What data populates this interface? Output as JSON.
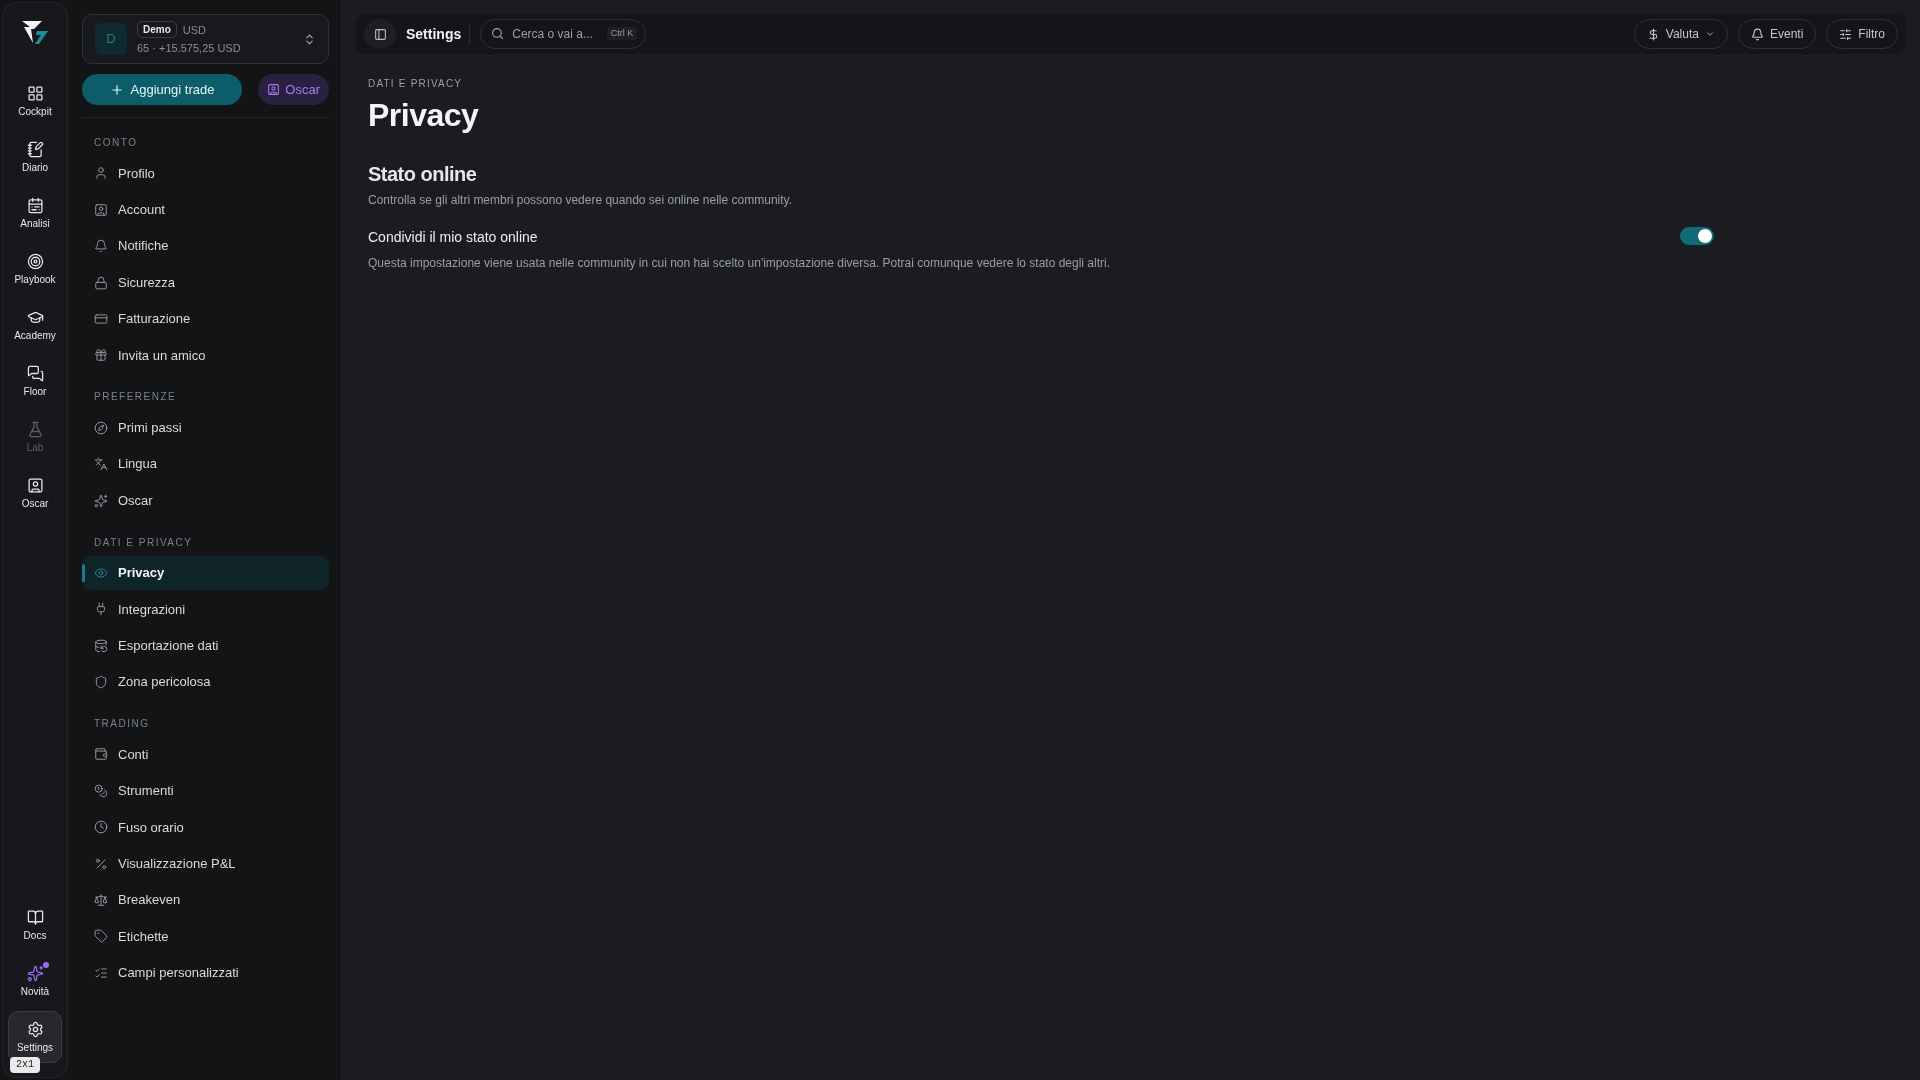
{
  "rail": {
    "top": [
      {
        "label": "Cockpit",
        "selected": false,
        "disabled": false,
        "has_dot": false
      },
      {
        "label": "Diario",
        "selected": false,
        "disabled": false,
        "has_dot": false
      },
      {
        "label": "Analisi",
        "selected": false,
        "disabled": false,
        "has_dot": false
      },
      {
        "label": "Playbook",
        "selected": false,
        "disabled": false,
        "has_dot": false
      },
      {
        "label": "Academy",
        "selected": false,
        "disabled": false,
        "has_dot": false
      },
      {
        "label": "Floor",
        "selected": false,
        "disabled": false,
        "has_dot": false
      },
      {
        "label": "Lab",
        "selected": false,
        "disabled": true,
        "has_dot": false
      },
      {
        "label": "Oscar",
        "selected": false,
        "disabled": false,
        "has_dot": false
      }
    ],
    "bottom": [
      {
        "label": "Docs",
        "selected": false,
        "disabled": false,
        "has_dot": false
      },
      {
        "label": "Novità",
        "selected": false,
        "disabled": false,
        "has_dot": true
      },
      {
        "label": "Settings",
        "selected": true,
        "disabled": false,
        "has_dot": false
      }
    ],
    "badge": "2x1"
  },
  "account": {
    "avatar": "D",
    "mode": "Demo",
    "currency": "USD",
    "summary": "65 · +15.575,25 USD"
  },
  "actions": {
    "add_trade": "Aggiungi trade",
    "oscar": "Oscar"
  },
  "sidebar": {
    "sections": [
      {
        "title": "CONTO",
        "items": [
          {
            "label": "Profilo",
            "selected": false
          },
          {
            "label": "Account",
            "selected": false
          },
          {
            "label": "Notifiche",
            "selected": false
          },
          {
            "label": "Sicurezza",
            "selected": false
          },
          {
            "label": "Fatturazione",
            "selected": false
          },
          {
            "label": "Invita un amico",
            "selected": false
          }
        ]
      },
      {
        "title": "PREFERENZE",
        "items": [
          {
            "label": "Primi passi",
            "selected": false
          },
          {
            "label": "Lingua",
            "selected": false
          },
          {
            "label": "Oscar",
            "selected": false
          }
        ]
      },
      {
        "title": "DATI E PRIVACY",
        "items": [
          {
            "label": "Privacy",
            "selected": true
          },
          {
            "label": "Integrazioni",
            "selected": false
          },
          {
            "label": "Esportazione dati",
            "selected": false
          },
          {
            "label": "Zona pericolosa",
            "selected": false
          }
        ]
      },
      {
        "title": "TRADING",
        "items": [
          {
            "label": "Conti",
            "selected": false
          },
          {
            "label": "Strumenti",
            "selected": false
          },
          {
            "label": "Fuso orario",
            "selected": false
          },
          {
            "label": "Visualizzazione P&L",
            "selected": false
          },
          {
            "label": "Breakeven",
            "selected": false
          },
          {
            "label": "Etichette",
            "selected": false
          },
          {
            "label": "Campi personalizzati",
            "selected": false
          }
        ]
      }
    ]
  },
  "topbar": {
    "title": "Settings",
    "search": {
      "placeholder": "Cerca o vai a...",
      "shortcut": "Ctrl K"
    },
    "buttons": [
      "Valuta",
      "Eventi",
      "Filtro"
    ]
  },
  "page": {
    "breadcrumb": "DATI E PRIVACY",
    "title": "Privacy",
    "section": {
      "title": "Stato online",
      "description": "Controlla se gli altri membri possono vedere quando sei online nelle community.",
      "settings": [
        {
          "label": "Condividi il mio stato online",
          "description": "Questa impostazione viene usata nelle community in cui non hai scelto un'impostazione diversa. Potrai comunque vedere lo stato degli altri.",
          "on": true
        }
      ]
    }
  }
}
